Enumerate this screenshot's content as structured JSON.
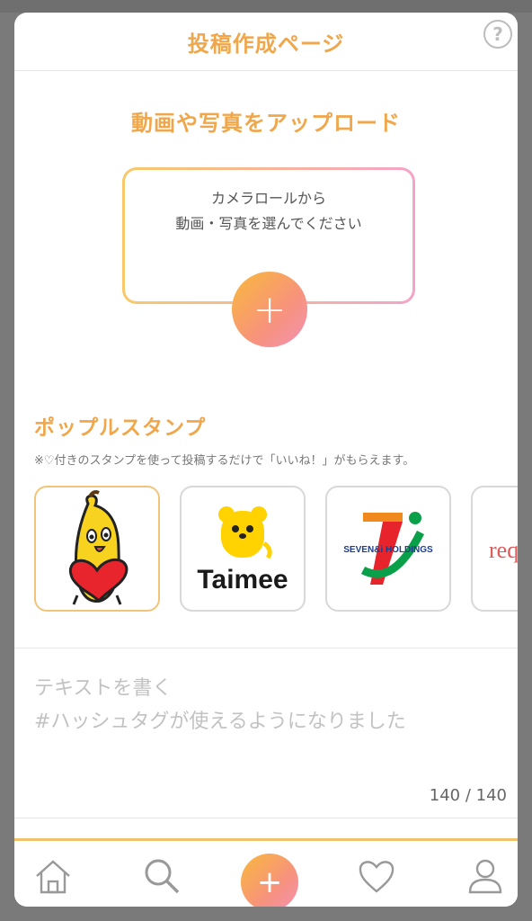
{
  "header": {
    "title": "投稿作成ページ",
    "help_label": "?"
  },
  "upload": {
    "heading": "動画や写真をアップロード",
    "box_line1": "カメラロールから",
    "box_line2": "動画・写真を選んでください",
    "add_label": "+"
  },
  "stamps": {
    "heading": "ポップルスタンプ",
    "note": "※♡付きのスタンプを使って投稿するだけで「いいね！」がもらえます。",
    "items": [
      {
        "name": "banana-heart",
        "selected": true
      },
      {
        "name": "Taimee",
        "text": "Taimee"
      },
      {
        "name": "Seven & i Holdings",
        "text": "SEVEN&i HOLDINGS",
        "mark": "7i"
      },
      {
        "name": "req",
        "text": "req"
      }
    ]
  },
  "composer": {
    "placeholder": "テキストを書く\n#ハッシュタグが使えるようになりました",
    "counter": "140 / 140"
  },
  "tabbar": {
    "items": [
      "home-icon",
      "search-icon",
      "post-icon",
      "heart-icon",
      "user-icon"
    ],
    "post_label": "+"
  },
  "colors": {
    "accent": "#f0a64a",
    "gradient_start": "#f9b93b",
    "gradient_end": "#f390b5",
    "overlay": "#7a7a7a"
  }
}
